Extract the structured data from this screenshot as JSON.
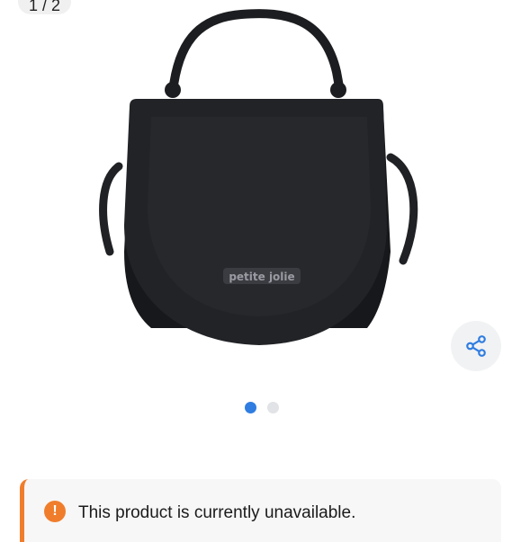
{
  "gallery": {
    "counter": "1 / 2",
    "product_image_alt": "black saddle handbag",
    "brand_logo_text": "petite jolie",
    "pagination": {
      "count": 2,
      "active": 1
    }
  },
  "share": {
    "icon": "share-icon"
  },
  "notice": {
    "icon": "alert-icon",
    "icon_glyph": "!",
    "message": "This product is currently unavailable.",
    "accent_color": "#f07d2c"
  },
  "colors": {
    "accent": "#2f7de1",
    "dot_inactive": "#e1e3e6"
  }
}
